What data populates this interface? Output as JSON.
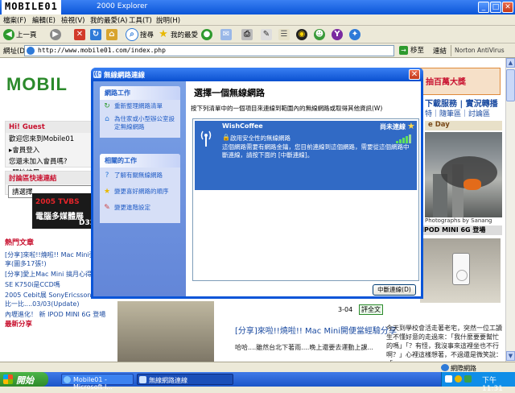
{
  "window": {
    "watermark": "MOBILE01",
    "title": "Mobile01 - Microsoft Internet Explorer",
    "title_visible": "2000  Explorer",
    "min": "_",
    "max": "□",
    "close": "✕"
  },
  "menu": [
    "檔案(F)",
    "編輯(E)",
    "檢視(V)",
    "我的最愛(A)",
    "工具(T)",
    "說明(H)"
  ],
  "toolbar": {
    "back": "上一頁",
    "search": "搜尋",
    "favorites": "我的最愛"
  },
  "address": {
    "label": "網址(D)",
    "url": "http://www.mobile01.com/index.php",
    "go": "移至",
    "links": "連結",
    "norton": "Norton AntiVirus"
  },
  "page": {
    "logo": "MOBIL",
    "promo": "抽百萬大獎",
    "topnav1": "下載服務 | 實況轉播",
    "topnav2": "特｜隨筆區｜討論區",
    "greeting_title": "Hi! Guest",
    "greeting_lines": [
      "歡迎您來到Mobile01",
      "▸會員登入",
      "您還未加入會員嗎?",
      "▸開始註冊"
    ],
    "forum_title": "討論區快速連結",
    "forum_select": "請選擇",
    "ad_line1": "2005 TVBS",
    "ad_line2": "電腦多媒體展",
    "ad_line3": "D325",
    "hot_title": "熱門文章",
    "hot_items": [
      "[分享]來啦!!燒啦!! Mac Mini彈...驗分享(圖多17張!)",
      "[分享]愛上Mac Mini 搞月心得",
      "SE K750i是CCD嗎",
      "2005 Cebit展 SonyEricsson...全機種比一比....03/03(Update)",
      "內壢進化！ 新 IPOD MINI 6G 登場"
    ],
    "recent_share": "最新分享",
    "right_day": "e Day",
    "photo_credit": "Photographs by Sanang",
    "ipod_head": "IPOD MINI 6G 登場",
    "page_label": "3-04",
    "prev_btn": "評全文",
    "news_head": "[分享]來啦!!燒啦!! Mac Mini開便當經驗分享",
    "news_body": "哈哈....雖然台北下著雨....晚上還要去運動上課...",
    "right_body": "今天到學校會活走著老宅，突然一位工讀生不懂好意的走過來：「我什麼要要幫忙的嗎」「？有怪，我沒事來這裡坐也不行啊？」心裡這樣想著，不過還是微笑說：「..."
  },
  "dialog": {
    "title": "無線網路連線",
    "tasks_network_title": "網路工作",
    "tasks_network": [
      "重新整理網路清單",
      "為住家或小型辦公室設定無線網路"
    ],
    "tasks_related_title": "相關的工作",
    "tasks_related": [
      "了解有關無線網路",
      "變更喜好網路的順序",
      "變更進階設定"
    ],
    "heading": "選擇一個無線網路",
    "subtitle": "按下列清單中的一個項目來連線到範圍內的無線網路或取得其他資訊(W)",
    "network": {
      "name": "WishCoffee",
      "status": "尚未連線",
      "security": "啟用安全性的無線網路",
      "description": "這個網路需要有網路金鑰，您目前連線到這個網路，需要從這個網路中斷連線，請按下面的 [中斷連線]。",
      "signal": 4
    },
    "connect_button": "中斷連線(D)"
  },
  "statusbar": {
    "text": "網際網路"
  },
  "taskbar": {
    "start": "開始",
    "task1": "Mobile01 - Microsoft I...",
    "task2": "無線網路連線",
    "clock": "下午 11:31"
  }
}
